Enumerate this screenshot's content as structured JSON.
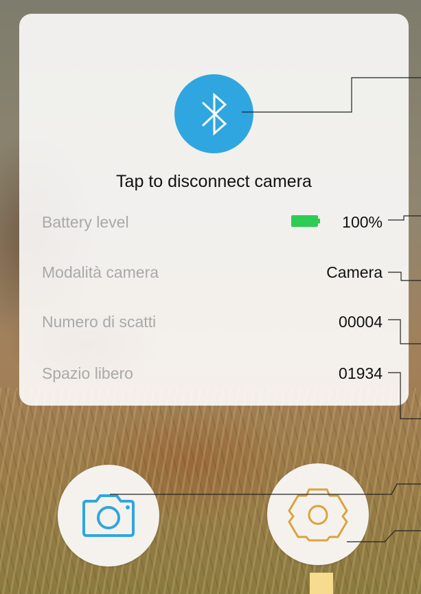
{
  "connection": {
    "icon": "bluetooth-icon",
    "label": "Tap to disconnect camera",
    "accent": "#2fa6df"
  },
  "status": [
    {
      "key": "battery",
      "label": "Battery level",
      "value": "100%",
      "level_fraction": 1.0,
      "icon": "battery-icon",
      "color": "#2ecc55"
    },
    {
      "key": "mode",
      "label": "Modalità camera",
      "value": "Camera"
    },
    {
      "key": "shots",
      "label": "Numero di scatti",
      "value": "00004"
    },
    {
      "key": "space",
      "label": "Spazio libero",
      "value": "01934"
    }
  ],
  "actions": {
    "camera": {
      "icon": "camera-icon",
      "color": "#2fa6df"
    },
    "settings": {
      "icon": "gear-icon",
      "color": "#d9a33c"
    }
  }
}
